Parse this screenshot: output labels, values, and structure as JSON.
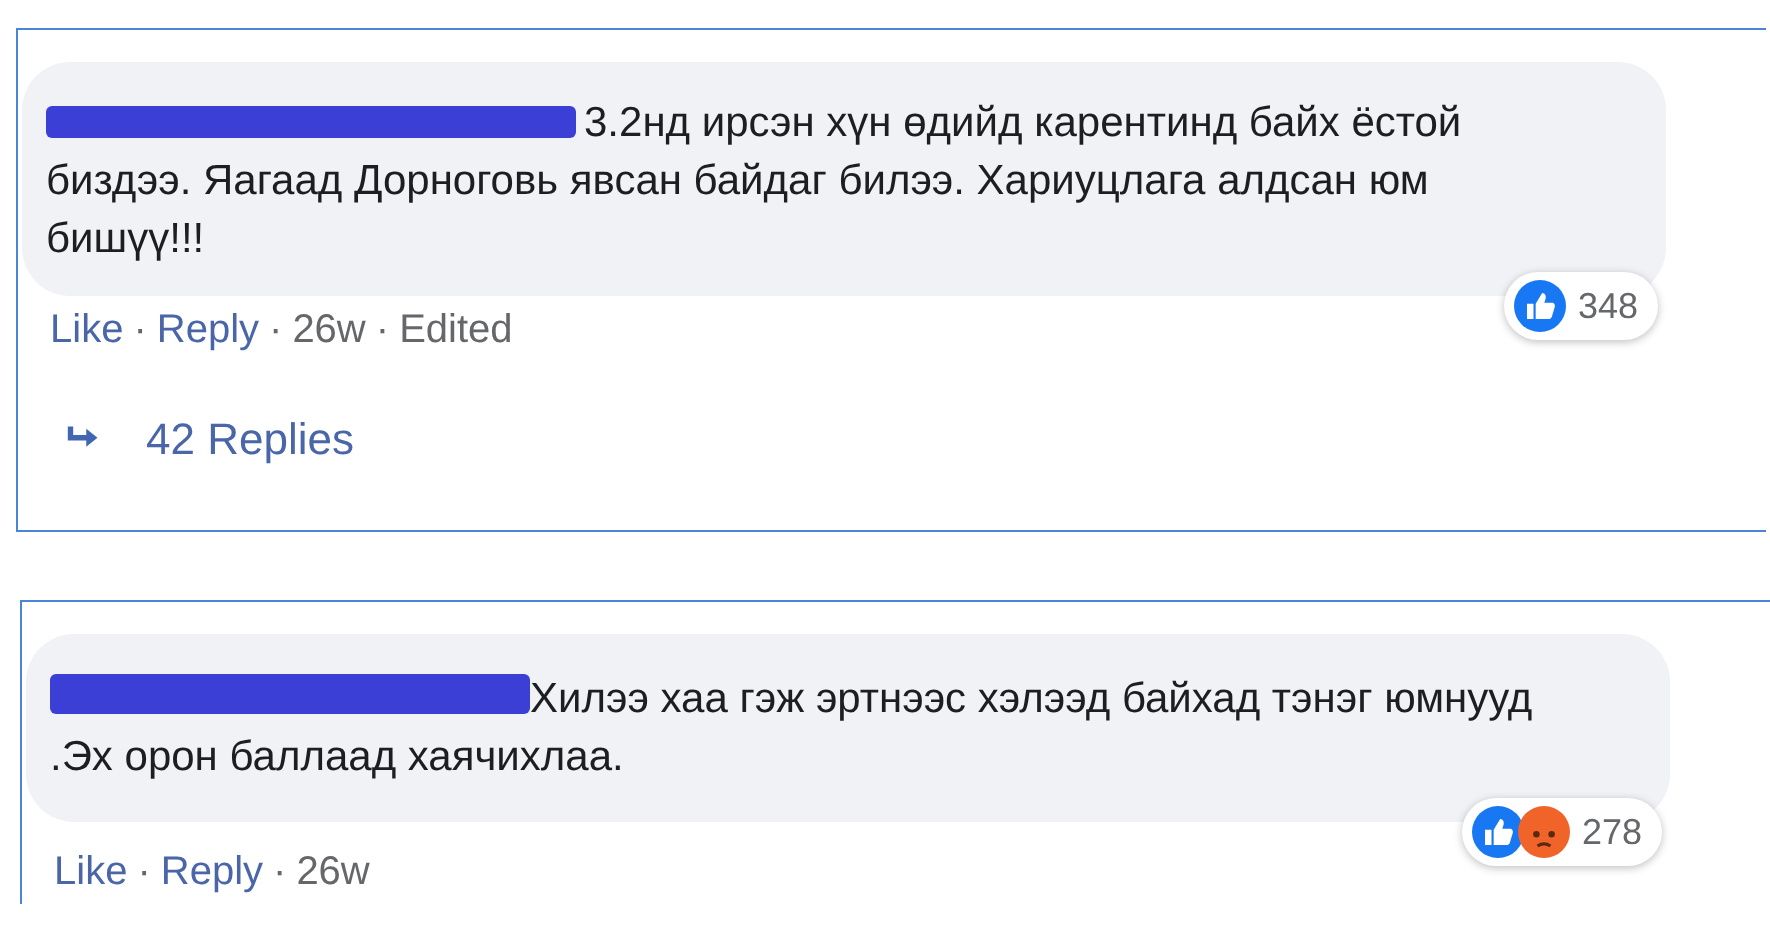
{
  "comments": [
    {
      "text": "3.2нд ирсэн хүн өдийд карентинд байх ёстой биздээ. Яагаад Дорноговь явсан байдаг билээ. Хариуцлага алдсан юм бишүү!!!",
      "reactions": [
        {
          "kind": "like"
        }
      ],
      "reaction_count": "348",
      "meta": [
        {
          "kind": "link",
          "text": "Like"
        },
        {
          "kind": "separator",
          "text": "·"
        },
        {
          "kind": "link",
          "text": "Reply"
        },
        {
          "kind": "separator",
          "text": "·"
        },
        {
          "kind": "age",
          "text": "26w"
        },
        {
          "kind": "separator",
          "text": "·"
        },
        {
          "kind": "edited",
          "text": "Edited"
        }
      ],
      "replies": "42 Replies"
    },
    {
      "text": "Хилээ хаа гэж эртнээс хэлээд байхад тэнэг юмнууд .Эх орон баллаад хаячихлаа.",
      "reactions": [
        {
          "kind": "like"
        },
        {
          "kind": "angry"
        }
      ],
      "reaction_count": "278",
      "meta": [
        {
          "kind": "link",
          "text": "Like"
        },
        {
          "kind": "separator",
          "text": "·"
        },
        {
          "kind": "link",
          "text": "Reply"
        },
        {
          "kind": "separator",
          "text": "·"
        },
        {
          "kind": "age",
          "text": "26w"
        }
      ]
    }
  ]
}
